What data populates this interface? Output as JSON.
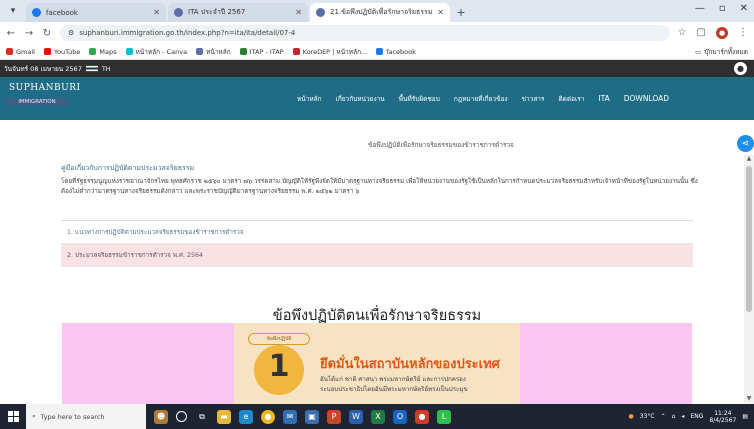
{
  "browser": {
    "tabs": [
      {
        "title": "facebook",
        "favicon_color": "#1877f2",
        "active": false
      },
      {
        "title": "ITA ประจำปี 2567",
        "favicon_color": "#5b6ea8",
        "active": false
      },
      {
        "title": "21.ข้อพึงปฏิบัติเพื่อรักษาจริยธรรม",
        "favicon_color": "#5b6ea8",
        "active": true
      }
    ],
    "new_tab_label": "+",
    "url": "suphanburi.immigration.go.th/index.php?n=ita/ita/detail/07-4",
    "bookmarks": [
      {
        "label": "Gmail",
        "color": "#d93025"
      },
      {
        "label": "YouTube",
        "color": "#ff0000"
      },
      {
        "label": "Maps",
        "color": "#34a853"
      },
      {
        "label": "หน้าหลัก - Canva",
        "color": "#00c4cc"
      },
      {
        "label": "หน้าหลัก",
        "color": "#5b6ea8"
      },
      {
        "label": "ITAP - ITAP",
        "color": "#2e7d32"
      },
      {
        "label": "KoreDEP | หน้าหลัก...",
        "color": "#c62828"
      },
      {
        "label": "facebook",
        "color": "#1877f2"
      }
    ],
    "all_bookmarks_label": "บุ๊กมาร์กทั้งหมด"
  },
  "site": {
    "top_date": "วันจันทร์ 08 เมษายน 2567",
    "flag_label": "TH",
    "logo_name": "SUPHANBURI",
    "logo_sub": "IMMIGRATION",
    "menu": [
      "หน้าหลัก",
      "เกี่ยวกับหน่วยงาน",
      "พื้นที่รับผิดชอบ",
      "กฎหมายที่เกี่ยวข้อง",
      "ข่าวสาร",
      "ติดต่อเรา",
      "ITA",
      "DOWNLOAD"
    ],
    "breadcrumb": "ข้อพึงปฏิบัติเพื่อรักษาจริยธรรมของข้าราชการตำรวจ",
    "section_title": "คู่มือเกี่ยวกับการปฏิบัติตามประมวลจริยธรรม",
    "intro_text": "โดยที่รัฐธรรมนูญแห่งราชอาณาจักรไทย พุทธศักราช ๒๕๖๐ มาตรา ๗๖ วรรคสาม บัญญัติให้รัฐพึงจัดให้มีมาตรฐานทางจริยธรรม เพื่อให้หน่วยงานของรัฐใช้เป็นหลักในการกำหนดประมวลจริยธรรมสำหรับเจ้าหน้าที่ของรัฐในหน่วยงานนั้น ซึ่งต้องไม่ต่ำกว่ามาตรฐานทางจริยธรรมดังกล่าว และพระราชบัญญัติมาตรฐานทางจริยธรรม พ.ศ. ๒๕๖๒ มาตรา ๖",
    "links": [
      "1. แนวทางการปฏิบัติตามประมวลจริยธรรมของข้าราชการตำรวจ",
      "2. ประมวลจริยธรรมข้าราชการตำรวจ พ.ศ. 2564"
    ],
    "big_heading": "ข้อพึงปฏิบัติตนเพื่อรักษาจริยธรรม",
    "poster": {
      "ribbon": "ข้อพึงปฏิบัติ",
      "number": "1",
      "headline": "ยึดมั่นในสถาบันหลักของประเทศ",
      "line1": "อันได้แก่ ชาติ ศาสนา พระมหากษัตริย์ และการปกครอง",
      "line2": "ระบอบประชาธิปไตยอันมีพระมหากษัตริย์ทรงเป็นประมุข"
    }
  },
  "taskbar": {
    "search_placeholder": "Type here to search",
    "weather": "33°C",
    "lang": "ENG",
    "time": "11:24",
    "date": "8/4/2567"
  }
}
